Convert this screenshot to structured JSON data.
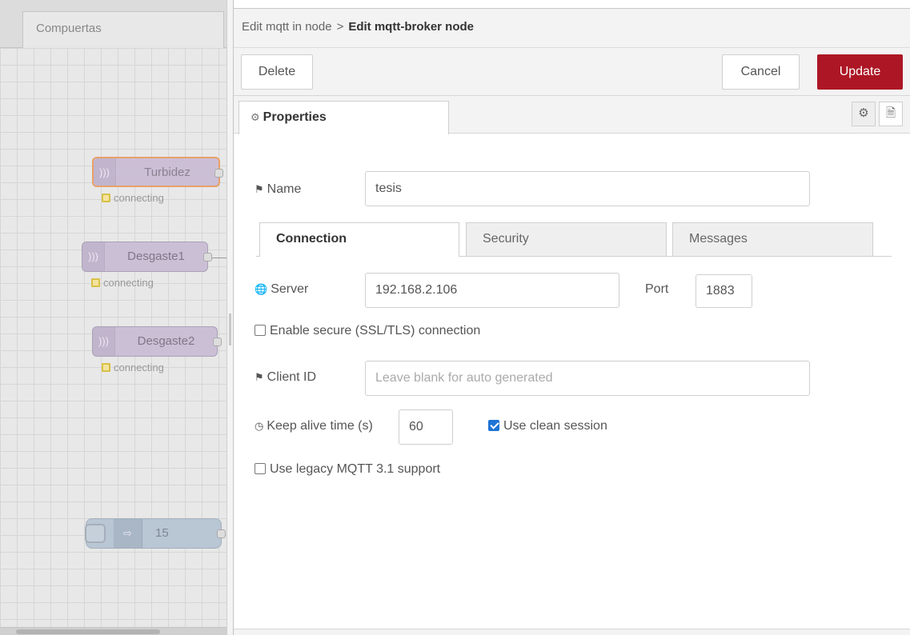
{
  "workspace": {
    "tab_label": "Compuertas",
    "nodes": [
      {
        "label": "Turbidez",
        "status": "connecting"
      },
      {
        "label": "Desgaste1",
        "status": "connecting"
      },
      {
        "label": "Desgaste2",
        "status": "connecting"
      },
      {
        "label": "15"
      }
    ]
  },
  "tray": {
    "breadcrumb": {
      "parent": "Edit mqtt in node",
      "separator": ">",
      "current": "Edit mqtt-broker node"
    },
    "buttons": {
      "delete": "Delete",
      "cancel": "Cancel",
      "update": "Update"
    },
    "tabs": {
      "properties": "Properties"
    },
    "form": {
      "name_label": "Name",
      "name_value": "tesis",
      "subtabs": [
        "Connection",
        "Security",
        "Messages"
      ],
      "server_label": "Server",
      "server_value": "192.168.2.106",
      "port_label": "Port",
      "port_value": "1883",
      "ssl_label": "Enable secure (SSL/TLS) connection",
      "ssl_checked": false,
      "client_id_label": "Client ID",
      "client_id_placeholder": "Leave blank for auto generated",
      "keepalive_label": "Keep alive time (s)",
      "keepalive_value": "60",
      "clean_session_label": "Use clean session",
      "clean_session_checked": true,
      "legacy_label": "Use legacy MQTT 3.1 support",
      "legacy_checked": false
    }
  },
  "colors": {
    "update_button": "#ad1625",
    "checkbox_on": "#1f74d6",
    "node_highlight": "#e8a06a"
  },
  "icons": {
    "properties_tab": "gear-icon",
    "settings_button": "gear-icon",
    "info_button": "document-icon",
    "name": "tag-icon",
    "server": "globe-icon",
    "client_id": "tag-icon",
    "keepalive": "clock-icon"
  }
}
